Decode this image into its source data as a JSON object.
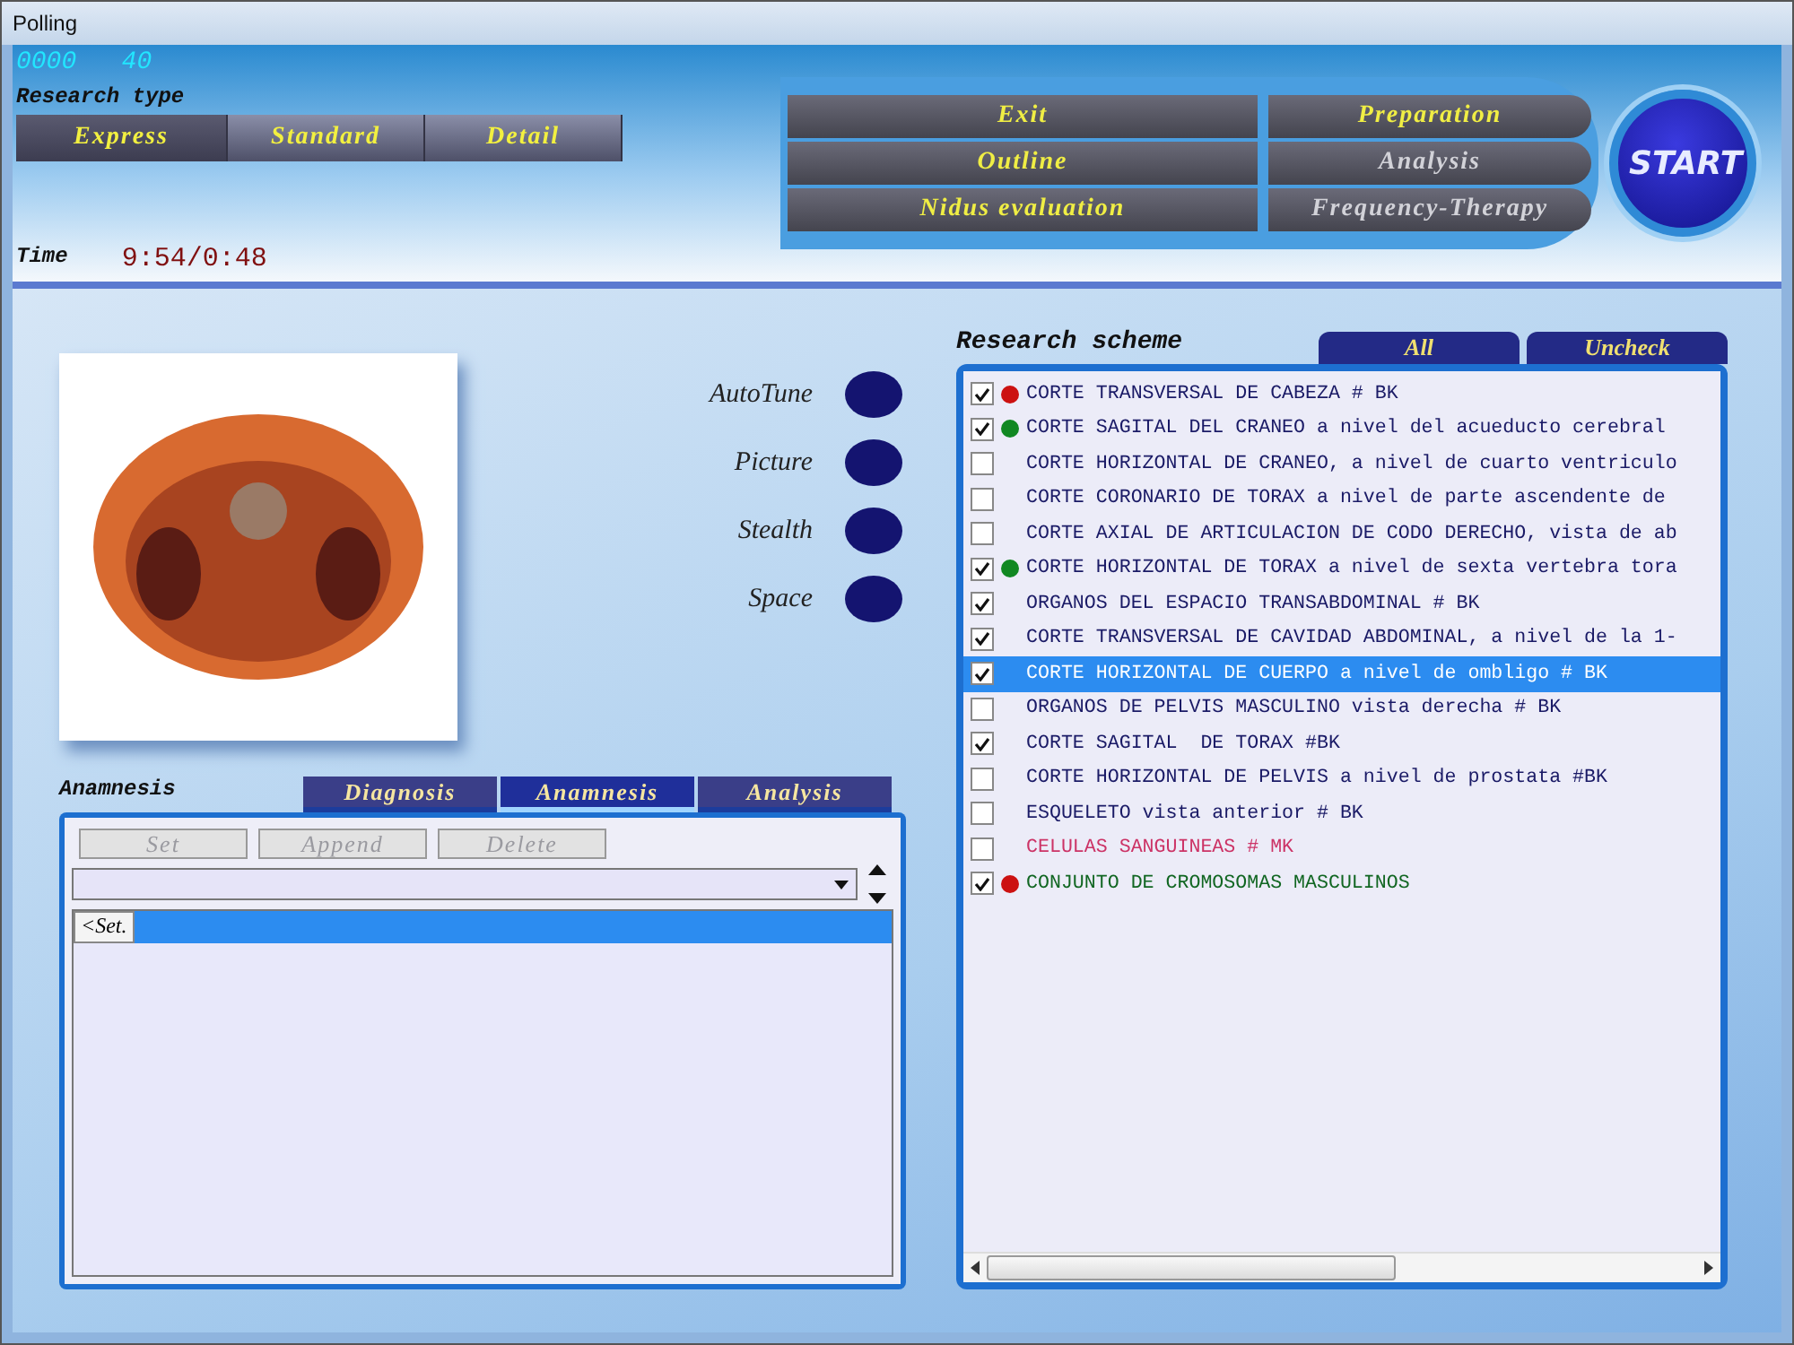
{
  "window": {
    "title": "Polling"
  },
  "counter": "0000   40",
  "research_type": {
    "label": "Research type",
    "options": [
      {
        "label": "Express",
        "selected": true
      },
      {
        "label": "Standard",
        "selected": false
      },
      {
        "label": "Detail",
        "selected": false
      }
    ]
  },
  "time": {
    "label": "Time",
    "value": "9:54/0:48"
  },
  "menu_left": [
    {
      "label": "Exit",
      "disabled": false
    },
    {
      "label": "Outline",
      "disabled": false
    },
    {
      "label": "Nidus evaluation",
      "disabled": false
    }
  ],
  "menu_right": [
    {
      "label": "Preparation",
      "disabled": false
    },
    {
      "label": "Analysis",
      "disabled": true
    },
    {
      "label": "Frequency-Therapy",
      "disabled": true
    }
  ],
  "start_button": "START",
  "toggles": [
    {
      "label": "AutoTune",
      "on": false
    },
    {
      "label": "Picture",
      "on": false
    },
    {
      "label": "Stealth",
      "on": false
    },
    {
      "label": "Space",
      "on": false
    }
  ],
  "anamnesis": {
    "label": "Anamnesis",
    "tabs": [
      {
        "label": "Diagnosis",
        "selected": false
      },
      {
        "label": "Anamnesis",
        "selected": true
      },
      {
        "label": "Analysis",
        "selected": false
      }
    ],
    "buttons": [
      {
        "label": "Set",
        "disabled": true
      },
      {
        "label": "Append",
        "disabled": true
      },
      {
        "label": "Delete",
        "disabled": true
      }
    ],
    "list": [
      {
        "label": "<Set.",
        "selected": true
      }
    ]
  },
  "research_scheme": {
    "title": "Research scheme",
    "tabs": [
      {
        "label": "All",
        "selected": false
      },
      {
        "label": "Uncheck",
        "selected": false
      }
    ],
    "items": [
      {
        "text": "CORTE TRANSVERSAL DE CABEZA # BK",
        "checked": true,
        "color": "#cc1111",
        "kind": "normal",
        "selected": false
      },
      {
        "text": "CORTE SAGITAL DEL CRANEO a nivel del acueducto cerebral",
        "checked": true,
        "color": "#118822",
        "kind": "normal",
        "selected": false
      },
      {
        "text": "CORTE HORIZONTAL DE CRANEO, a nivel de cuarto ventriculo",
        "checked": false,
        "kind": "normal",
        "selected": false
      },
      {
        "text": "CORTE CORONARIO DE TORAX a nivel de parte ascendente de",
        "checked": false,
        "kind": "normal",
        "selected": false
      },
      {
        "text": "CORTE AXIAL DE ARTICULACION DE CODO DERECHO, vista de ab",
        "checked": false,
        "kind": "normal",
        "selected": false
      },
      {
        "text": "CORTE HORIZONTAL DE TORAX a nivel de sexta vertebra tora",
        "checked": true,
        "color": "#118822",
        "kind": "normal",
        "selected": false
      },
      {
        "text": "ORGANOS DEL ESPACIO TRANSABDOMINAL # BK",
        "checked": true,
        "kind": "normal",
        "selected": false
      },
      {
        "text": "CORTE TRANSVERSAL DE CAVIDAD ABDOMINAL, a nivel de la 1-",
        "checked": true,
        "kind": "normal",
        "selected": false
      },
      {
        "text": "CORTE HORIZONTAL DE CUERPO a nivel de ombligo # BK",
        "checked": true,
        "kind": "normal",
        "selected": true
      },
      {
        "text": "ORGANOS DE PELVIS MASCULINO vista derecha # BK",
        "checked": false,
        "kind": "normal",
        "selected": false
      },
      {
        "text": "CORTE SAGITAL  DE TORAX #BK",
        "checked": true,
        "kind": "normal",
        "selected": false
      },
      {
        "text": "CORTE HORIZONTAL DE PELVIS a nivel de prostata #BK",
        "checked": false,
        "kind": "normal",
        "selected": false
      },
      {
        "text": "ESQUELETO vista anterior # BK",
        "checked": false,
        "kind": "normal",
        "selected": false
      },
      {
        "text": "CELULAS SANGUINEAS # MK",
        "checked": false,
        "kind": "cells",
        "selected": false
      },
      {
        "text": "CONJUNTO DE CROMOSOMAS MASCULINOS",
        "checked": true,
        "color": "#cc1111",
        "kind": "chromosomes",
        "selected": false
      }
    ]
  }
}
